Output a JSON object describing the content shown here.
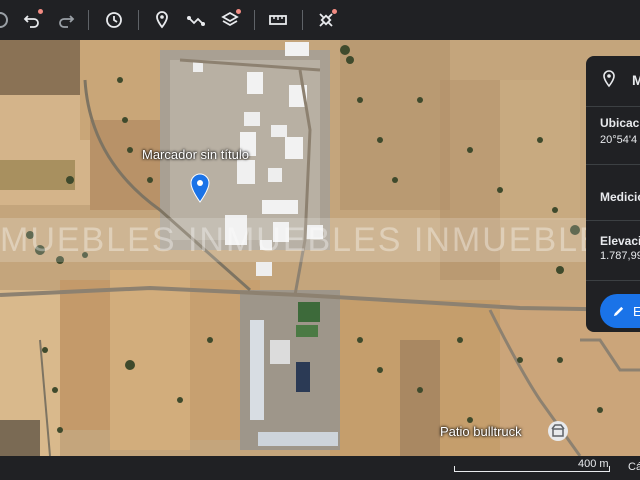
{
  "toolbar": {
    "icons": [
      "undo-icon",
      "redo-icon",
      "history-icon",
      "placemark-icon",
      "path-icon",
      "layers-icon",
      "ruler-icon",
      "satellite-icon"
    ],
    "accent": "#f28b82"
  },
  "map": {
    "marker": {
      "label": "Marcador sin título",
      "color": "#1a73e8"
    },
    "poi": {
      "label": "Patio bulltruck",
      "icon": "business-icon"
    },
    "watermark": "MUEBLES INMUEBLES INMUEBLES INMUEBLES INMUEBLES"
  },
  "panel": {
    "title": "M",
    "location_label": "Ubicaci",
    "location_value": "20°54'4",
    "measure_label": "Medicio",
    "elevation_label": "Elevaci",
    "elevation_value": "1.787,99",
    "edit_label": "E"
  },
  "footer": {
    "scale": "400 m",
    "text": "Cá"
  }
}
